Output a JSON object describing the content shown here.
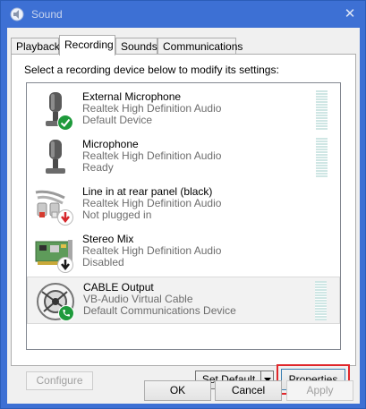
{
  "window": {
    "title": "Sound",
    "close_glyph": "✕"
  },
  "tabs": [
    {
      "label": "Playback",
      "active": false
    },
    {
      "label": "Recording",
      "active": true
    },
    {
      "label": "Sounds",
      "active": false
    },
    {
      "label": "Communications",
      "active": false
    }
  ],
  "instruction": "Select a recording device below to modify its settings:",
  "devices": [
    {
      "name": "External Microphone",
      "driver": "Realtek High Definition Audio",
      "status": "Default Device",
      "icon": "microphone-icon",
      "badge": "default-check",
      "selected": false
    },
    {
      "name": "Microphone",
      "driver": "Realtek High Definition Audio",
      "status": "Ready",
      "icon": "microphone-icon",
      "badge": "none",
      "selected": false
    },
    {
      "name": "Line in at rear panel (black)",
      "driver": "Realtek High Definition Audio",
      "status": "Not plugged in",
      "icon": "line-in-cable-icon",
      "badge": "unplugged-arrow",
      "selected": false
    },
    {
      "name": "Stereo Mix",
      "driver": "Realtek High Definition Audio",
      "status": "Disabled",
      "icon": "sound-card-icon",
      "badge": "disabled-arrow",
      "selected": false
    },
    {
      "name": "CABLE Output",
      "driver": "VB-Audio Virtual Cable",
      "status": "Default Communications Device",
      "icon": "virtual-cable-icon",
      "badge": "communications-phone",
      "selected": true
    }
  ],
  "buttons": {
    "configure": "Configure",
    "set_default": "Set Default",
    "properties": "Properties",
    "ok": "OK",
    "cancel": "Cancel",
    "apply": "Apply"
  },
  "colors": {
    "title_bar": "#3d70d4",
    "highlight": "#e0272b",
    "check_badge": "#1e9a3b",
    "unplugged_badge": "#d6262b"
  }
}
